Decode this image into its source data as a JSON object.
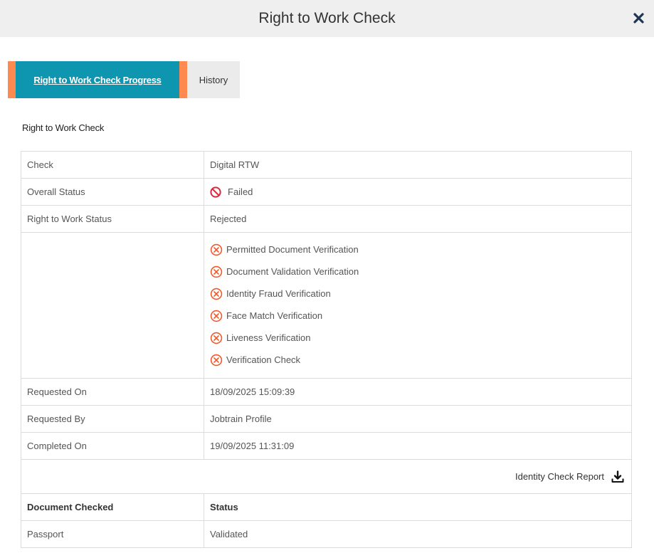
{
  "modal": {
    "title": "Right to Work Check"
  },
  "tabs": {
    "progress": "Right to Work Check Progress",
    "history": "History"
  },
  "section": {
    "title": "Right to Work Check"
  },
  "details": {
    "check": {
      "label": "Check",
      "value": "Digital RTW"
    },
    "overall_status": {
      "label": "Overall Status",
      "value": "Failed"
    },
    "rtw_status": {
      "label": "Right to Work Status",
      "value": "Rejected"
    },
    "verifications": [
      "Permitted Document Verification",
      "Document Validation Verification",
      "Identity Fraud Verification",
      "Face Match Verification",
      "Liveness Verification",
      "Verification Check"
    ],
    "requested_on": {
      "label": "Requested On",
      "value": "18/09/2025 15:09:39"
    },
    "requested_by": {
      "label": "Requested By",
      "value": "Jobtrain Profile"
    },
    "completed_on": {
      "label": "Completed On",
      "value": "19/09/2025 11:31:09"
    },
    "report_link": "Identity Check Report"
  },
  "documents": {
    "header_document": "Document Checked",
    "header_status": "Status",
    "rows": [
      {
        "document": "Passport",
        "status": "Validated"
      }
    ]
  },
  "colors": {
    "accent": "#0e95b0",
    "tab_border": "#ff8a50",
    "fail_red": "#d9283a",
    "fail_orange": "#f05a2b"
  },
  "icons": {
    "close": "close-icon",
    "failed": "prohibited-icon",
    "verification_failed": "circle-x-icon",
    "download": "download-icon"
  }
}
